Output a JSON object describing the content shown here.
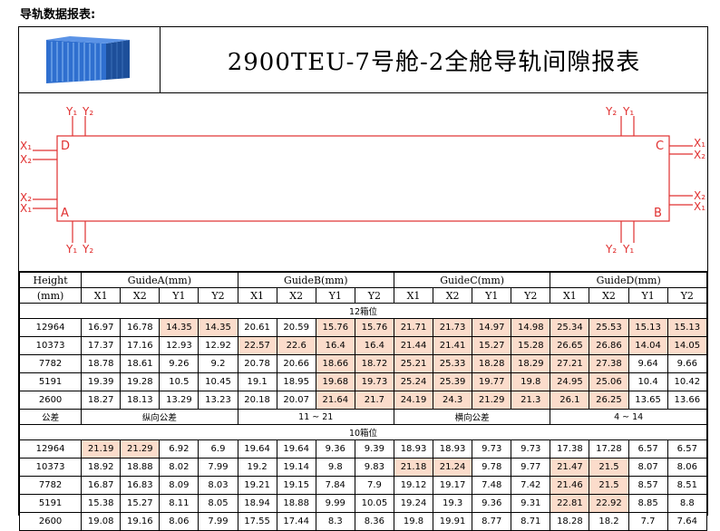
{
  "heading": "导轨数据报表:",
  "title": "2900TEU-7号舱-2全舱导轨间隙报表",
  "diagram": {
    "corners": [
      "D",
      "C",
      "A",
      "B"
    ],
    "axis": {
      "x1": "X₁",
      "x2": "X₂",
      "y1": "Y₁",
      "y2": "Y₂"
    }
  },
  "table": {
    "height_label": "Height",
    "height_unit": "(mm)",
    "guides": [
      "GuideA(mm)",
      "GuideB(mm)",
      "GuideC(mm)",
      "GuideD(mm)"
    ],
    "subcols": [
      "X1",
      "X2",
      "Y1",
      "Y2"
    ],
    "sections": [
      {
        "name": "12箱位",
        "rows": [
          {
            "h": "12964",
            "v": [
              "16.97",
              "16.78",
              "14.35",
              "14.35",
              "20.61",
              "20.59",
              "15.76",
              "15.76",
              "21.71",
              "21.73",
              "14.97",
              "14.98",
              "25.34",
              "25.53",
              "15.13",
              "15.13"
            ],
            "hl": [
              2,
              3,
              6,
              7,
              8,
              9,
              10,
              11,
              12,
              13,
              14,
              15
            ]
          },
          {
            "h": "10373",
            "v": [
              "17.37",
              "17.16",
              "12.93",
              "12.92",
              "22.57",
              "22.6",
              "16.4",
              "16.4",
              "21.44",
              "21.41",
              "15.27",
              "15.28",
              "26.65",
              "26.86",
              "14.04",
              "14.05"
            ],
            "hl": [
              4,
              5,
              6,
              7,
              8,
              9,
              10,
              11,
              12,
              13,
              14,
              15
            ]
          },
          {
            "h": "7782",
            "v": [
              "18.78",
              "18.61",
              "9.26",
              "9.2",
              "20.78",
              "20.66",
              "18.66",
              "18.72",
              "25.21",
              "25.33",
              "18.28",
              "18.29",
              "27.21",
              "27.38",
              "9.64",
              "9.66"
            ],
            "hl": [
              6,
              7,
              8,
              9,
              10,
              11,
              12,
              13
            ]
          },
          {
            "h": "5191",
            "v": [
              "19.39",
              "19.28",
              "10.5",
              "10.45",
              "19.1",
              "18.95",
              "19.68",
              "19.73",
              "25.24",
              "25.39",
              "19.77",
              "19.8",
              "24.95",
              "25.06",
              "10.4",
              "10.42"
            ],
            "hl": [
              6,
              7,
              8,
              9,
              10,
              11,
              12,
              13
            ]
          },
          {
            "h": "2600",
            "v": [
              "18.27",
              "18.13",
              "13.29",
              "13.23",
              "20.18",
              "20.07",
              "21.64",
              "21.7",
              "24.19",
              "24.3",
              "21.29",
              "21.3",
              "26.1",
              "26.25",
              "13.65",
              "13.66"
            ],
            "hl": [
              6,
              7,
              8,
              9,
              10,
              11,
              12,
              13
            ]
          }
        ],
        "tolerance": {
          "label": "公差",
          "c1": "纵向公差",
          "c2": "11 ~ 21",
          "c3": "横向公差",
          "c4": "4 ~ 14"
        }
      },
      {
        "name": "10箱位",
        "rows": [
          {
            "h": "12964",
            "v": [
              "21.19",
              "21.29",
              "6.92",
              "6.9",
              "19.64",
              "19.64",
              "9.36",
              "9.39",
              "18.93",
              "18.93",
              "9.73",
              "9.73",
              "17.38",
              "17.28",
              "6.57",
              "6.57"
            ],
            "hl": [
              0,
              1
            ]
          },
          {
            "h": "10373",
            "v": [
              "18.92",
              "18.88",
              "8.02",
              "7.99",
              "19.2",
              "19.14",
              "9.8",
              "9.83",
              "21.18",
              "21.24",
              "9.78",
              "9.77",
              "21.47",
              "21.5",
              "8.07",
              "8.06"
            ],
            "hl": [
              8,
              9,
              12,
              13
            ]
          },
          {
            "h": "7782",
            "v": [
              "16.87",
              "16.83",
              "8.09",
              "8.03",
              "19.21",
              "19.15",
              "7.84",
              "7.9",
              "19.12",
              "19.17",
              "7.48",
              "7.42",
              "21.46",
              "21.5",
              "8.57",
              "8.51"
            ],
            "hl": [
              12,
              13
            ]
          },
          {
            "h": "5191",
            "v": [
              "15.38",
              "15.27",
              "8.11",
              "8.05",
              "18.94",
              "18.88",
              "9.99",
              "10.05",
              "19.24",
              "19.3",
              "9.36",
              "9.31",
              "22.81",
              "22.92",
              "8.85",
              "8.8"
            ],
            "hl": [
              12,
              13
            ]
          },
          {
            "h": "2600",
            "v": [
              "19.08",
              "19.16",
              "8.06",
              "7.99",
              "17.55",
              "17.44",
              "8.3",
              "8.36",
              "19.8",
              "19.91",
              "8.77",
              "8.71",
              "18.28",
              "18.2",
              "7.7",
              "7.64"
            ],
            "hl": []
          }
        ]
      }
    ]
  }
}
